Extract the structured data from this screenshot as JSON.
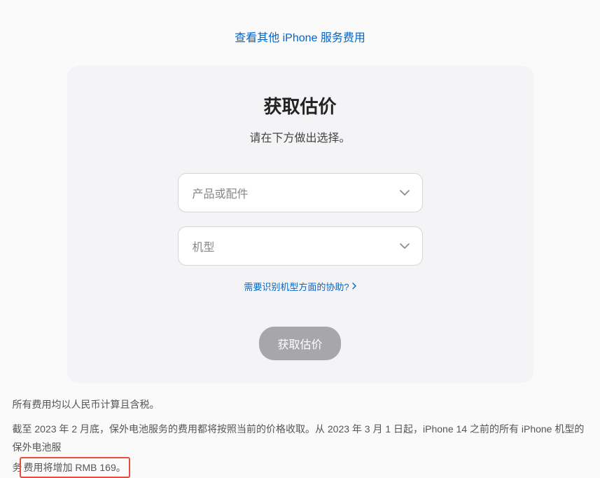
{
  "topLink": "查看其他 iPhone 服务费用",
  "card": {
    "title": "获取估价",
    "subtitle": "请在下方做出选择。",
    "select1Placeholder": "产品或配件",
    "select2Placeholder": "机型",
    "helpLink": "需要识别机型方面的协助?",
    "button": "获取估价"
  },
  "footer": {
    "line1": "所有费用均以人民币计算且含税。",
    "line2a": "截至 2023 年 2 月底，保外电池服务的费用都将按照当前的价格收取。从 2023 年 3 月 1 日起，iPhone 14 之前的所有 iPhone 机型的保外电池服",
    "line2b_prefix": "务",
    "line2b_highlight": "费用将增加 RMB 169。"
  }
}
